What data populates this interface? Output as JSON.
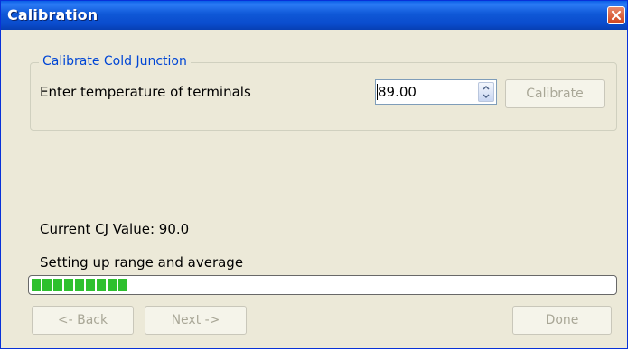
{
  "window": {
    "title": "Calibration"
  },
  "group": {
    "title": "Calibrate Cold Junction"
  },
  "form": {
    "terminals_label": "Enter temperature of terminals",
    "temperature_value": "89.00",
    "calibrate_label": "Calibrate"
  },
  "status": {
    "cj_value": "Current CJ Value: 90.0",
    "message": "Setting up range and average",
    "progress_fraction": 0.18,
    "progress_color": "#2ec02e"
  },
  "footer": {
    "back_label": "<- Back",
    "next_label": "Next ->",
    "done_label": "Done"
  },
  "colors": {
    "title_bar": "#0a58d7",
    "group_title": "#0046d5",
    "close_button": "#d0431c"
  }
}
